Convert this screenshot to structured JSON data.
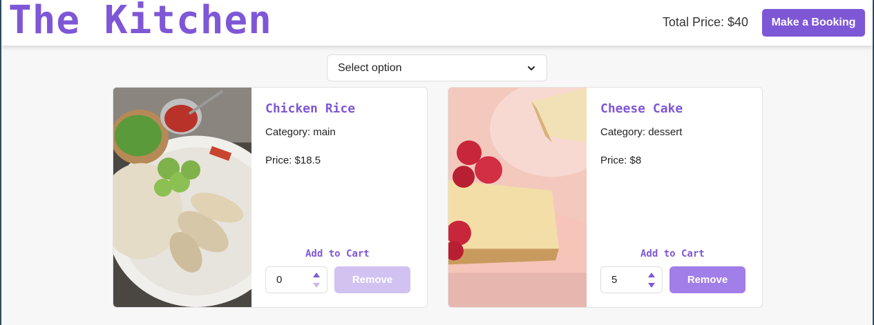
{
  "header": {
    "brand": "The Kitchen",
    "total_label": "Total Price: $40",
    "booking_button": "Make a Booking"
  },
  "filter": {
    "selected": "Select option"
  },
  "dishes": [
    {
      "name": "Chicken Rice",
      "category": "Category: main",
      "price": "Price: $18.5",
      "add_label": "Add to Cart",
      "quantity": "0",
      "remove_label": "Remove",
      "remove_enabled": false
    },
    {
      "name": "Cheese Cake",
      "category": "Category: dessert",
      "price": "Price: $8",
      "add_label": "Add to Cart",
      "quantity": "5",
      "remove_label": "Remove",
      "remove_enabled": true
    }
  ],
  "colors": {
    "accent": "#7e57d6",
    "remove_active": "#a27ee8",
    "remove_disabled": "#d2c2f1"
  },
  "icons": {
    "filter_chevron": "chevron-down-icon",
    "qty_up": "caret-up-icon",
    "qty_down": "caret-down-icon"
  }
}
